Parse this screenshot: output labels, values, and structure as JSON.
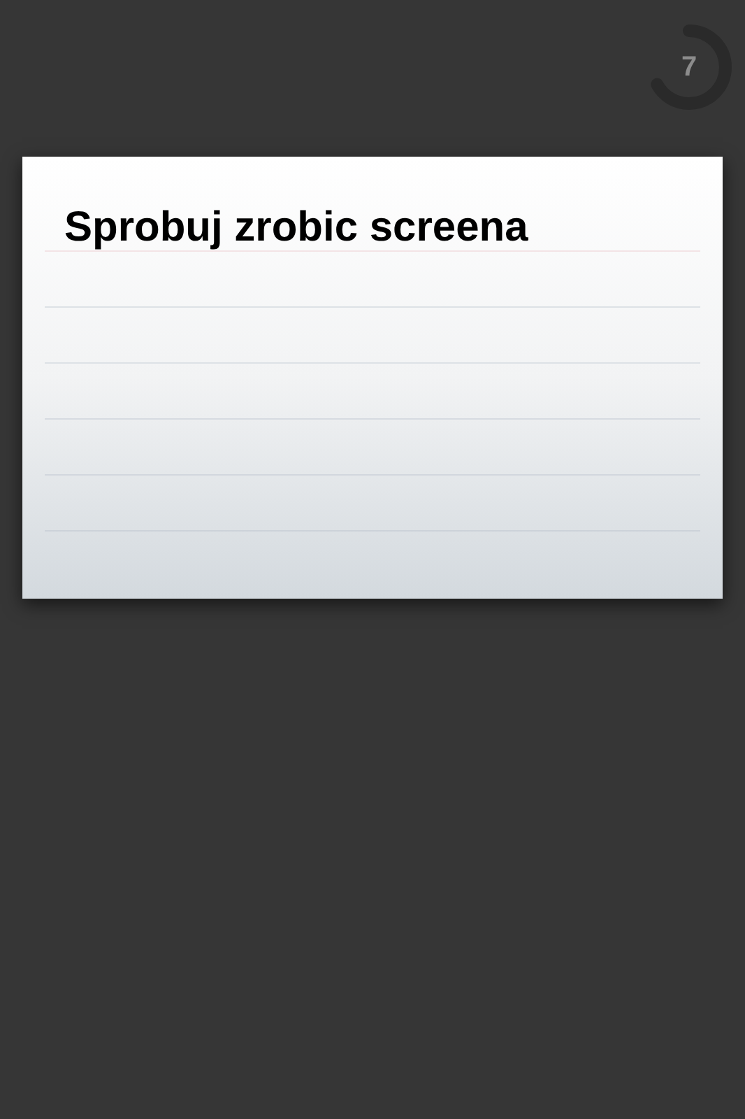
{
  "timer": {
    "count": "7"
  },
  "card": {
    "title": "Sprobuj zrobic screena"
  }
}
